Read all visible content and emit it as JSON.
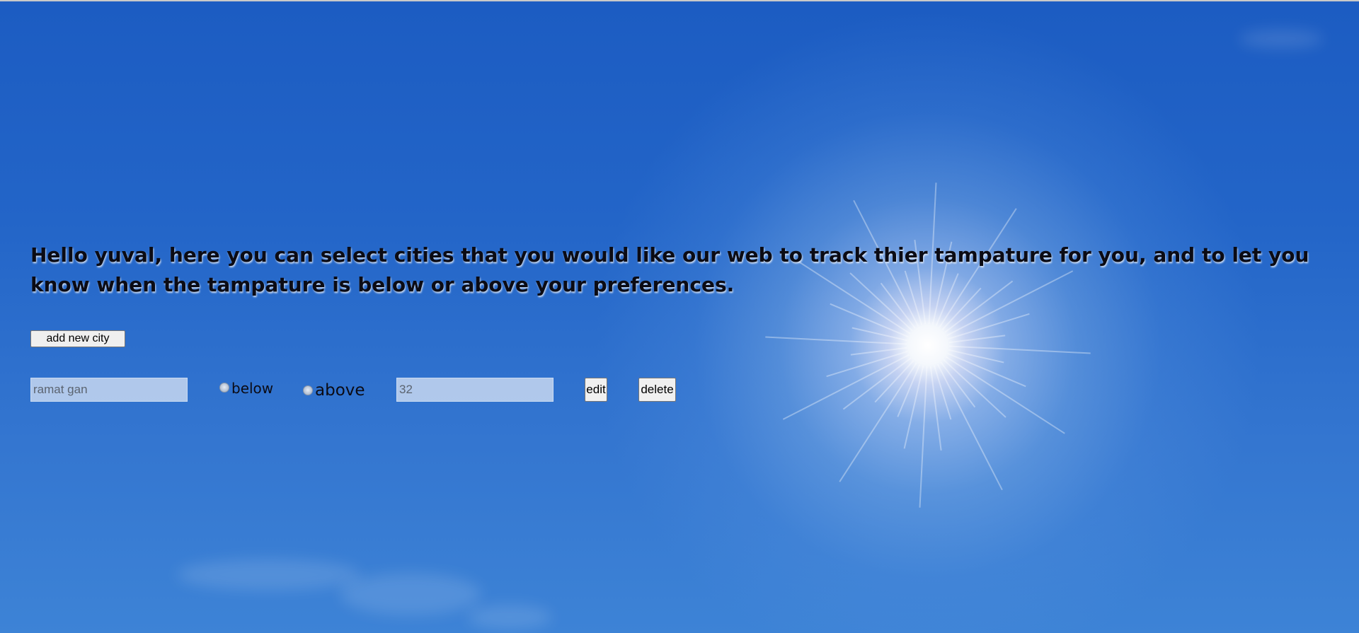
{
  "page": {
    "headline": "Hello yuval, here you can select cities that you would like our web to track thier tampature for you, and to let you know when the tampature is below or above your preferences."
  },
  "toolbar": {
    "add_city_label": "add new city"
  },
  "city_row": {
    "city_placeholder": "ramat gan",
    "below_label": "below",
    "above_label": "above",
    "below_checked": false,
    "above_checked": false,
    "temperature_placeholder": "32",
    "edit_label": "edit",
    "delete_label": "delete"
  },
  "colors": {
    "sky_top": "#1c5cc2",
    "sky_bottom": "#3d83d6",
    "headline_text": "#0b0b14"
  }
}
